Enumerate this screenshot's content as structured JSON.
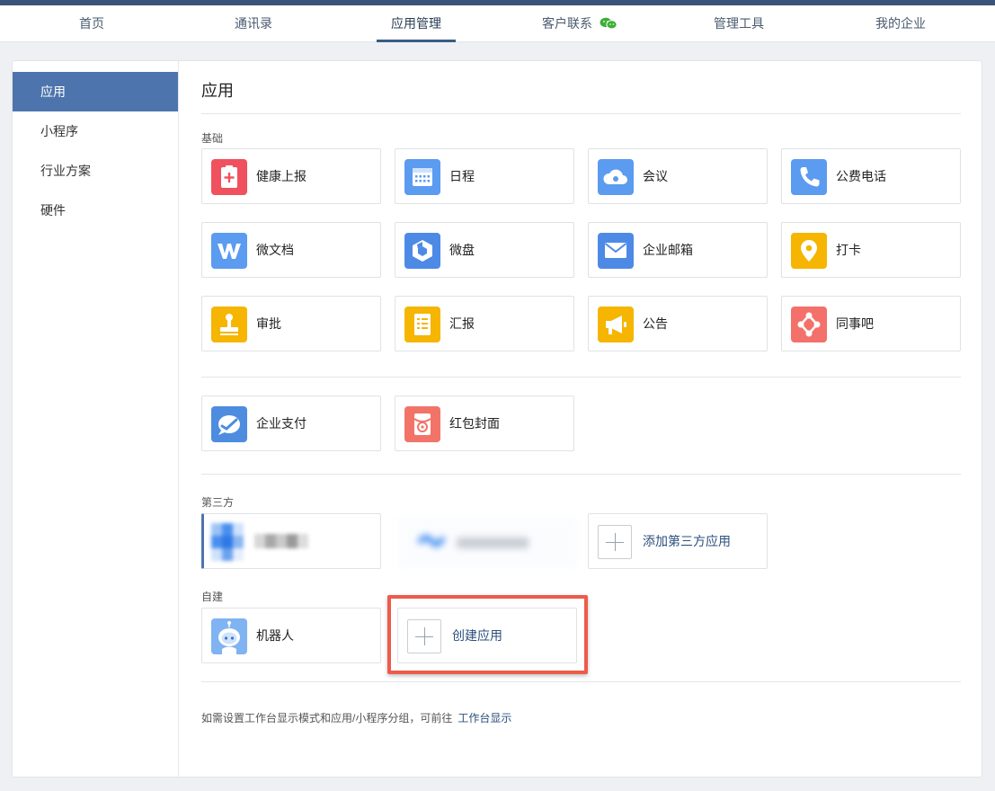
{
  "topnav": {
    "items": [
      {
        "label": "首页"
      },
      {
        "label": "通讯录"
      },
      {
        "label": "应用管理",
        "active": true
      },
      {
        "label": "客户联系"
      },
      {
        "label": "管理工具"
      },
      {
        "label": "我的企业"
      }
    ],
    "accent": "#3a5b8a"
  },
  "sidebar": {
    "items": [
      {
        "label": "应用",
        "active": true
      },
      {
        "label": "小程序"
      },
      {
        "label": "行业方案"
      },
      {
        "label": "硬件"
      }
    ],
    "active_color": "#4d74ad"
  },
  "main": {
    "title": "应用",
    "sections": {
      "basic": {
        "label": "基础",
        "apps": [
          {
            "label": "健康上报",
            "icon": "health-report-icon",
            "color": "#f0515e"
          },
          {
            "label": "日程",
            "icon": "calendar-icon",
            "color": "#5b9bf0"
          },
          {
            "label": "会议",
            "icon": "meeting-cloud-icon",
            "color": "#5b9bf0"
          },
          {
            "label": "公费电话",
            "icon": "phone-icon",
            "color": "#5b9bf0"
          },
          {
            "label": "微文档",
            "icon": "doc-w-icon",
            "color": "#5b9bf0"
          },
          {
            "label": "微盘",
            "icon": "drive-icon",
            "color": "#5b9bf0"
          },
          {
            "label": "企业邮箱",
            "icon": "mail-icon",
            "color": "#5b9bf0"
          },
          {
            "label": "打卡",
            "icon": "location-pin-icon",
            "color": "#f5b500"
          },
          {
            "label": "审批",
            "icon": "stamp-icon",
            "color": "#f5b500"
          },
          {
            "label": "汇报",
            "icon": "report-icon",
            "color": "#f5b500"
          },
          {
            "label": "公告",
            "icon": "megaphone-icon",
            "color": "#f5b500"
          },
          {
            "label": "同事吧",
            "icon": "colleague-network-icon",
            "color": "#f4706a"
          }
        ]
      },
      "payment": {
        "apps": [
          {
            "label": "企业支付",
            "icon": "payment-icon",
            "color": "#4e8ce0"
          },
          {
            "label": "红包封面",
            "icon": "red-packet-icon",
            "color": "#f27468"
          }
        ]
      },
      "third_party": {
        "label": "第三方",
        "add_label": "添加第三方应用"
      },
      "custom": {
        "label": "自建",
        "apps": [
          {
            "label": "机器人",
            "icon": "robot-icon",
            "color": "#7fb3f2"
          }
        ],
        "create_label": "创建应用"
      }
    },
    "footnote": {
      "text": "如需设置工作台显示模式和应用/小程序分组，可前往",
      "link": "工作台显示"
    }
  },
  "highlight_color": "#ee5b4b"
}
